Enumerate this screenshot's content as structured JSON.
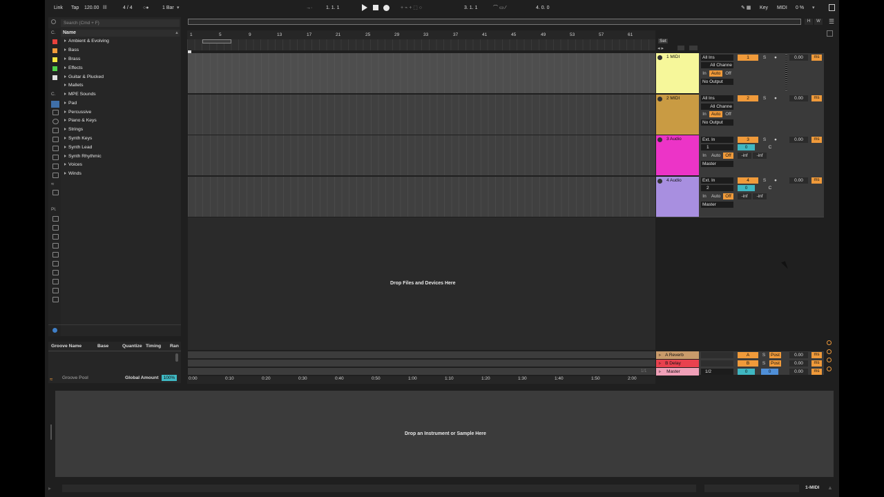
{
  "control_bar": {
    "link": "Link",
    "tap": "Tap",
    "tempo": "120.00",
    "signature": "4 / 4",
    "quantize": "1 Bar",
    "position": "1.  1.  1",
    "loop_start": "3.  1.  1",
    "loop_length": "4.  0.  0",
    "key": "Key",
    "midi": "MIDI",
    "cpu": "0 %"
  },
  "browser": {
    "search_placeholder": "Search (Cmd + F)",
    "name_header": "Name",
    "categories_label": "C.",
    "places_label": "Pl.",
    "items": [
      {
        "label": "Ambient & Evolving"
      },
      {
        "label": "Bass"
      },
      {
        "label": "Brass"
      },
      {
        "label": "Effects"
      },
      {
        "label": "Guitar & Plucked"
      },
      {
        "label": "Mallets"
      },
      {
        "label": "MPE Sounds"
      },
      {
        "label": "Pad"
      },
      {
        "label": "Percussive"
      },
      {
        "label": "Piano & Keys"
      },
      {
        "label": "Strings"
      },
      {
        "label": "Synth Keys"
      },
      {
        "label": "Synth Lead"
      },
      {
        "label": "Synth Rhythmic"
      },
      {
        "label": "Voices"
      },
      {
        "label": "Winds"
      }
    ]
  },
  "groove_pool": {
    "columns": [
      "Groove Name",
      "Base",
      "Quantize",
      "Timing",
      "Ran"
    ],
    "title": "Groove Pool",
    "global_amount_label": "Global Amount",
    "global_amount_value": "100%"
  },
  "ruler": {
    "bars": [
      "1",
      "5",
      "9",
      "13",
      "17",
      "21",
      "25",
      "29",
      "33",
      "37",
      "41",
      "45",
      "49",
      "53",
      "57",
      "61"
    ],
    "times": [
      "0:00",
      "0:10",
      "0:20",
      "0:30",
      "0:40",
      "0:50",
      "1:00",
      "1:10",
      "1:20",
      "1:30",
      "1:40",
      "1:50",
      "2:00"
    ],
    "set_label": "Set"
  },
  "tracks": [
    {
      "name": "1 MIDI",
      "color": "#f6f79a",
      "input": "All Ins",
      "channel": "All Channe",
      "monitor": [
        "In",
        "Auto",
        "Off"
      ],
      "output": "No Output",
      "number": "1",
      "solo": "S",
      "volume": "0.00",
      "ms": "ms"
    },
    {
      "name": "2 MIDI",
      "color": "#c99b43",
      "input": "All Ins",
      "channel": "All Channe",
      "monitor": [
        "In",
        "Auto",
        "Off"
      ],
      "output": "No Output",
      "number": "2",
      "solo": "S",
      "volume": "0.00",
      "ms": "ms"
    },
    {
      "name": "3 Audio",
      "color": "#ec34c7",
      "input": "Ext. In",
      "channel": "1",
      "monitor": [
        "In",
        "Auto",
        "Off"
      ],
      "output": "Master",
      "number": "3",
      "solo": "S",
      "send": "0",
      "pan": "C",
      "meter_l": "-inf",
      "meter_r": "-inf",
      "volume": "0.00",
      "ms": "ms"
    },
    {
      "name": "4 Audio",
      "color": "#a88fe0",
      "input": "Ext. In",
      "channel": "2",
      "monitor": [
        "In",
        "Auto",
        "Off"
      ],
      "output": "Master",
      "number": "4",
      "solo": "S",
      "send": "0",
      "pan": "C",
      "meter_l": "-inf",
      "meter_r": "-inf",
      "volume": "0.00",
      "ms": "ms"
    }
  ],
  "returns": [
    {
      "name": "A Reverb",
      "color": "#c99b6b",
      "letter": "A",
      "solo": "S",
      "post": "Post",
      "volume": "0.00",
      "ms": "ms"
    },
    {
      "name": "B Delay",
      "color": "#e8414e",
      "letter": "B",
      "solo": "S",
      "post": "Post",
      "volume": "0.00",
      "ms": "ms"
    },
    {
      "name": "Master",
      "color": "#f0a0b8",
      "output": "1/2",
      "send": "0",
      "pan": "0",
      "volume": "0.00",
      "ms": "ms"
    }
  ],
  "arrangement": {
    "drop_text": "Drop Files and Devices Here",
    "loop_marker": "1/1"
  },
  "detail": {
    "drop_text": "Drop an Instrument or Sample Here",
    "selected_track": "1-MIDI"
  },
  "colors": {
    "orange": "#f09a3a",
    "teal": "#3fb7c2",
    "blue": "#4f8fd8"
  }
}
